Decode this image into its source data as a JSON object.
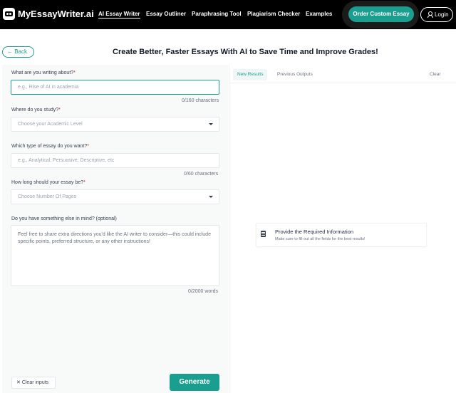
{
  "nav": {
    "logo_text": "MyEssayWriter.ai",
    "links": [
      {
        "label": "AI Essay Writer",
        "active": true
      },
      {
        "label": "Essay Outliner"
      },
      {
        "label": "Paraphrasing Tool"
      },
      {
        "label": "Plagiarism Checker"
      },
      {
        "label": "Examples"
      }
    ],
    "order_button": "Order Custom Essay",
    "login_button": "Login"
  },
  "header": {
    "back_button": "← Back",
    "title": "Create Better, Faster Essays With AI to Save Time and Improve Grades!"
  },
  "form": {
    "topic": {
      "label": "What are you writing about?",
      "required": "*",
      "placeholder": "e.g., Rise of AI in academia",
      "counter": "0/160 characters"
    },
    "level": {
      "label": "Where do you study?",
      "required": "*",
      "placeholder": "Choose your Academic Level"
    },
    "type": {
      "label": "Which type of essay do you want?",
      "required": "*",
      "placeholder": "e.g., Analytical, Persuasive, Descriptive, etc",
      "counter": "0/60 characters"
    },
    "length": {
      "label": "How long should your essay be?",
      "required": "*",
      "placeholder": "Choose Number Of Pages"
    },
    "extra": {
      "label": "Do you have something else in mind? (optional)",
      "placeholder": "Feel free to share extra directions you'd like the AI writer to consider—this could include specific points, preferred structure, or any other instructions!",
      "counter": "0/2000 words"
    },
    "clear_inputs": "✕ Clear inputs",
    "generate": "Generate"
  },
  "results": {
    "tabs": [
      {
        "label": "New Results",
        "active": true
      },
      {
        "label": "Previous Outputs"
      }
    ],
    "clear": "Clear",
    "empty_title": "Provide the Required Information",
    "empty_subtitle": "Make sure to fill out all the fields for the best results!"
  },
  "colors": {
    "accent": "#1a9e8f",
    "nav_bg": "#000000",
    "required": "#dc2626"
  }
}
